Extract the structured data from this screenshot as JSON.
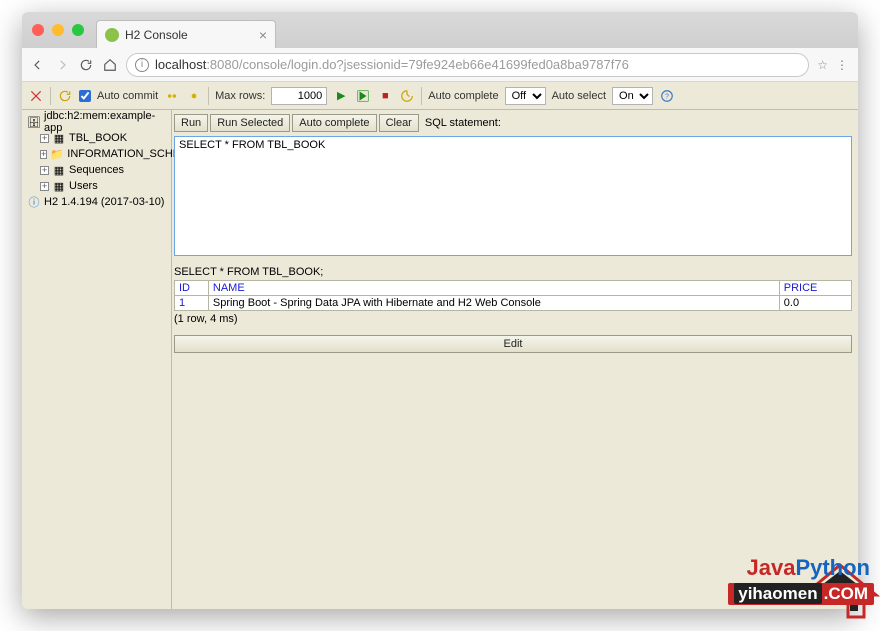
{
  "browser": {
    "tab_title": "H2 Console",
    "url_host": "localhost",
    "url_port": ":8080",
    "url_path": "/console/login.do?jsessionid=79fe924eb66e41699fed0a8ba9787f76"
  },
  "toolbar": {
    "auto_commit_label": "Auto commit",
    "max_rows_label": "Max rows:",
    "max_rows_value": "1000",
    "auto_complete_label": "Auto complete",
    "auto_complete_value": "Off",
    "auto_select_label": "Auto select",
    "auto_select_value": "On"
  },
  "sidebar": {
    "jdbc": "jdbc:h2:mem:example-app",
    "items": [
      {
        "label": "TBL_BOOK"
      },
      {
        "label": "INFORMATION_SCHEMA"
      },
      {
        "label": "Sequences"
      },
      {
        "label": "Users"
      }
    ],
    "version": "H2 1.4.194 (2017-03-10)"
  },
  "buttons": {
    "run": "Run",
    "run_selected": "Run Selected",
    "auto_complete": "Auto complete",
    "clear": "Clear",
    "sql_statement_label": "SQL statement:",
    "edit": "Edit"
  },
  "sql": {
    "text": "SELECT * FROM TBL_BOOK",
    "executed": "SELECT * FROM TBL_BOOK;"
  },
  "result": {
    "headers": [
      "ID",
      "NAME",
      "PRICE"
    ],
    "row": [
      "1",
      "Spring Boot - Spring Data JPA with Hibernate and H2 Web Console",
      "0.0"
    ],
    "stats": "(1 row, 4 ms)"
  },
  "watermark": {
    "line1a": "Java",
    "line1b": "Python",
    "line2a": "yihaomen",
    "line2b": ".COM"
  }
}
